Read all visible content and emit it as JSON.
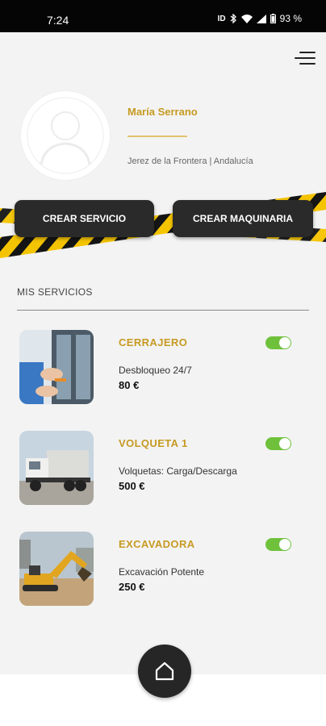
{
  "status_bar": {
    "time": "7:24",
    "battery": "93 %",
    "icons": [
      "data-icon",
      "bluetooth-icon",
      "wifi-icon",
      "signal-icon",
      "battery-icon"
    ]
  },
  "header": {
    "menu_icon": "menu-icon"
  },
  "profile": {
    "name": "María Serrano",
    "location": "Jerez de la Frontera | Andalucía",
    "avatar_icon": "user-icon"
  },
  "actions": {
    "crear_servicio": "CREAR SERVICIO",
    "crear_maquinaria": "CREAR MAQUINARIA"
  },
  "section": {
    "title": "MIS SERVICIOS"
  },
  "services": [
    {
      "name": "CERRAJERO",
      "description": "Desbloqueo 24/7",
      "price": "80 €",
      "active": true
    },
    {
      "name": "VOLQUETA 1",
      "description": "Volquetas: Carga/Descarga",
      "price": "500 €",
      "active": true
    },
    {
      "name": "EXCAVADORA",
      "description": "Excavación Potente",
      "price": "250 €",
      "active": true
    }
  ],
  "nav": {
    "home_icon": "home-icon"
  },
  "colors": {
    "accent": "#c69a22",
    "toggle_on": "#6fc13b",
    "button_bg": "#2a2a2a",
    "tape_yellow": "#f5c400"
  }
}
